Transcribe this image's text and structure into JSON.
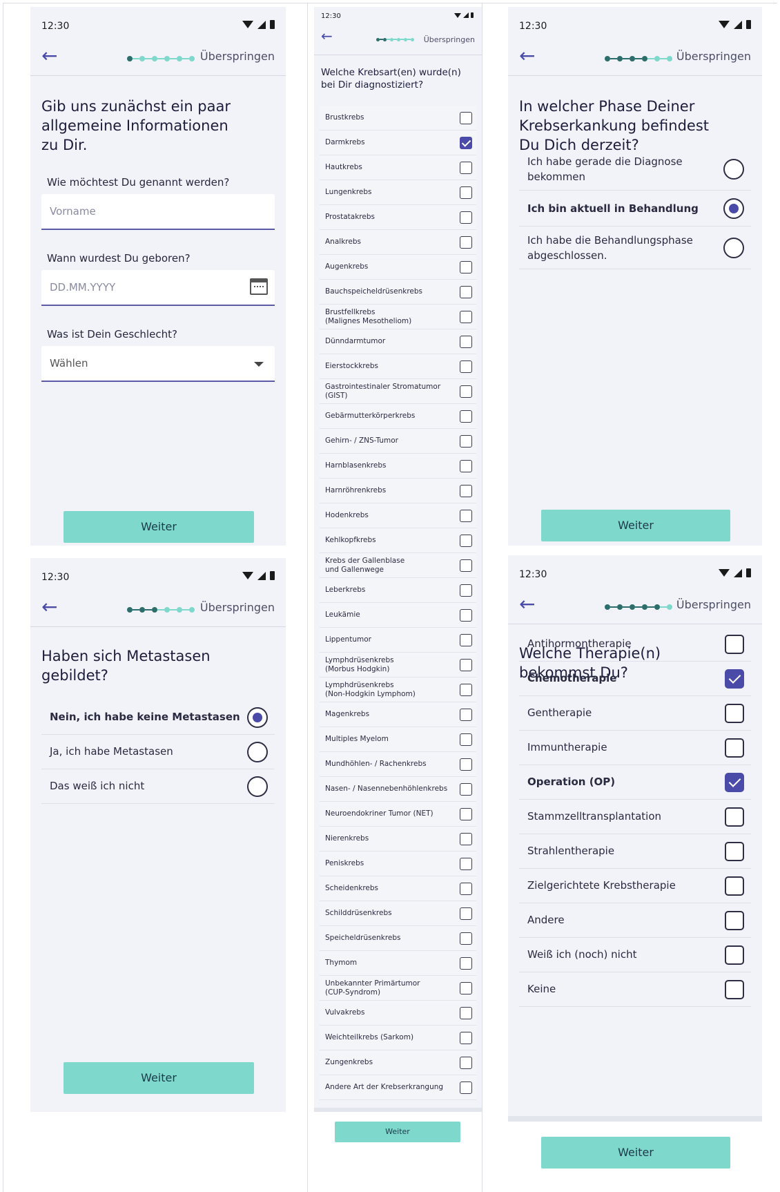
{
  "status": {
    "time": "12:30"
  },
  "nav": {
    "skip": "Überspringen",
    "back_icon": "arrow-left-icon"
  },
  "screen1": {
    "title": "Gib uns zunächst ein paar\nallgemeine Informationen\nzu Dir.",
    "name_label": "Wie möchtest Du genannt werden?",
    "name_placeholder": "Vorname",
    "birth_label": "Wann wurdest Du geboren?",
    "birth_placeholder": "DD.MM.YYYY",
    "gender_label": "Was ist Dein Geschlecht?",
    "gender_value": "Wählen",
    "button": "Weiter"
  },
  "screen2": {
    "title": "Welche Krebsart(en) wurde(n)\nbei Dir diagnostiziert?",
    "items": [
      {
        "label": "Brustkrebs",
        "checked": false
      },
      {
        "label": "Darmkrebs",
        "checked": true
      },
      {
        "label": "Hautkrebs",
        "checked": false
      },
      {
        "label": "Lungenkrebs",
        "checked": false
      },
      {
        "label": "Prostatakrebs",
        "checked": false
      },
      {
        "label": "Analkrebs",
        "checked": false
      },
      {
        "label": "Augenkrebs",
        "checked": false
      },
      {
        "label": "Bauchspeicheldrüsenkrebs",
        "checked": false
      },
      {
        "label": "Brustfellkrebs\n(Malignes Mesotheliom)",
        "checked": false
      },
      {
        "label": "Dünndarmtumor",
        "checked": false
      },
      {
        "label": "Eierstockkrebs",
        "checked": false
      },
      {
        "label": "Gastrointestinaler Stromatumor\n(GIST)",
        "checked": false
      },
      {
        "label": "Gebärmutterkörperkrebs",
        "checked": false
      },
      {
        "label": "Gehirn- / ZNS-Tumor",
        "checked": false
      },
      {
        "label": "Harnblasenkrebs",
        "checked": false
      },
      {
        "label": "Harnröhrenkrebs",
        "checked": false
      },
      {
        "label": "Hodenkrebs",
        "checked": false
      },
      {
        "label": "Kehlkopfkrebs",
        "checked": false
      },
      {
        "label": "Krebs der Gallenblase\nund Gallenwege",
        "checked": false
      },
      {
        "label": "Leberkrebs",
        "checked": false
      },
      {
        "label": "Leukämie",
        "checked": false
      },
      {
        "label": "Lippentumor",
        "checked": false
      },
      {
        "label": "Lymphdrüsenkrebs\n(Morbus Hodgkin)",
        "checked": false
      },
      {
        "label": "Lymphdrüsenkrebs\n(Non-Hodgkin Lymphom)",
        "checked": false
      },
      {
        "label": "Magenkrebs",
        "checked": false
      },
      {
        "label": "Multiples Myelom",
        "checked": false
      },
      {
        "label": "Mundhöhlen- / Rachenkrebs",
        "checked": false
      },
      {
        "label": "Nasen- / Nasennebenhöhlenkrebs",
        "checked": false
      },
      {
        "label": "Neuroendokriner Tumor (NET)",
        "checked": false
      },
      {
        "label": "Nierenkrebs",
        "checked": false
      },
      {
        "label": "Peniskrebs",
        "checked": false
      },
      {
        "label": "Scheidenkrebs",
        "checked": false
      },
      {
        "label": "Schilddrüsenkrebs",
        "checked": false
      },
      {
        "label": "Speicheldrüsenkrebs",
        "checked": false
      },
      {
        "label": "Thymom",
        "checked": false
      },
      {
        "label": "Unbekannter Primärtumor\n(CUP-Syndrom)",
        "checked": false
      },
      {
        "label": "Vulvakrebs",
        "checked": false
      },
      {
        "label": "Weichteilkrebs (Sarkom)",
        "checked": false
      },
      {
        "label": "Zungenkrebs",
        "checked": false
      },
      {
        "label": "Andere Art der Krebserkrangung",
        "checked": false
      }
    ],
    "button": "Weiter"
  },
  "screen3": {
    "title": "In welcher Phase Deiner\nKrebserkankung befindest\nDu Dich derzeit?",
    "options": [
      {
        "label": "Ich habe gerade die Diagnose\nbekommen",
        "selected": false
      },
      {
        "label": "Ich bin aktuell in Behandlung",
        "selected": true
      },
      {
        "label": "Ich habe die Behandlungsphase\nabgeschlossen.",
        "selected": false
      }
    ],
    "button": "Weiter"
  },
  "screen4": {
    "title": "Haben sich Metastasen\ngebildet?",
    "options": [
      {
        "label": "Nein, ich habe keine Metastasen",
        "selected": true
      },
      {
        "label": "Ja, ich habe Metastasen",
        "selected": false
      },
      {
        "label": "Das weiß ich nicht",
        "selected": false
      }
    ],
    "button": "Weiter"
  },
  "screen5": {
    "title": "Welche Therapie(n)\nbekommst Du?",
    "items": [
      {
        "label": "Antihormontherapie",
        "checked": false
      },
      {
        "label": "Chemotherapie",
        "checked": true
      },
      {
        "label": "Gentherapie",
        "checked": false
      },
      {
        "label": "Immuntherapie",
        "checked": false
      },
      {
        "label": "Operation (OP)",
        "checked": true
      },
      {
        "label": "Stammzelltransplantation",
        "checked": false
      },
      {
        "label": "Strahlentherapie",
        "checked": false
      },
      {
        "label": "Zielgerichtete Krebstherapie",
        "checked": false
      },
      {
        "label": "Andere",
        "checked": false
      },
      {
        "label": "Weiß ich (noch) nicht",
        "checked": false
      },
      {
        "label": "Keine",
        "checked": false
      }
    ],
    "button": "Weiter"
  },
  "colors": {
    "accent": "#4a4aa8",
    "button": "#7fd8cc",
    "progress_done": "#2d6e6c",
    "background": "#f1f3f9"
  }
}
